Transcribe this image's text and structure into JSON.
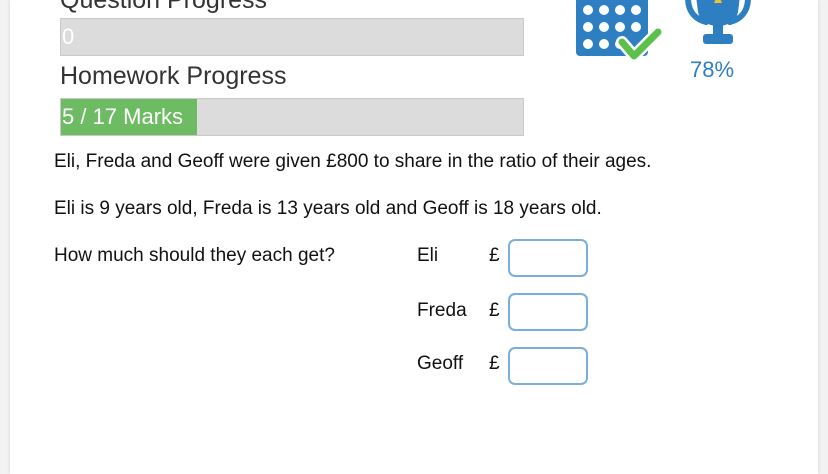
{
  "progress": {
    "question_label": "Question Progress",
    "question_value_text": "0",
    "question_fraction": 0,
    "homework_label": "Homework Progress",
    "homework_value_text": "5 / 17 Marks",
    "homework_marks": 5,
    "homework_total": 17
  },
  "stats": {
    "percent_text": "78%",
    "grid_icon": "calendar-grid-check-icon",
    "trophy_icon": "trophy-icon"
  },
  "question": {
    "line1": "Eli, Freda and Geoff were given £800 to share in the ratio of their ages.",
    "line2": "Eli is 9 years old, Freda is 13 years old and Geoff is 18 years old.",
    "prompt": "How much should they each get?"
  },
  "answers": [
    {
      "name": "Eli",
      "currency": "£",
      "value": ""
    },
    {
      "name": "Freda",
      "currency": "£",
      "value": ""
    },
    {
      "name": "Geoff",
      "currency": "£",
      "value": ""
    }
  ],
  "colors": {
    "accent": "#2d7fc2",
    "progress_fill": "#6dbb63",
    "check": "#5cc04a",
    "input_border": "#7aaedc"
  }
}
